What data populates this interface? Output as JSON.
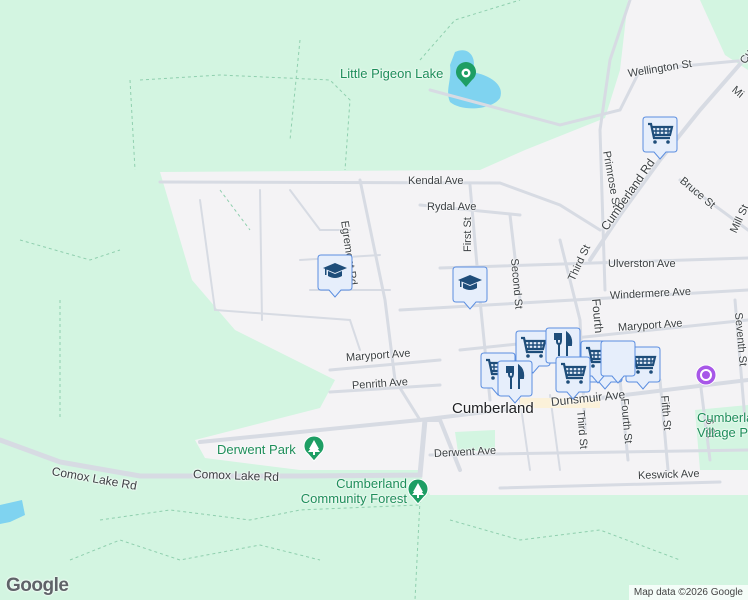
{
  "map": {
    "town_label": "Cumberland",
    "streets": [
      "Kendal Ave",
      "Rydal Ave",
      "Egremont Rd",
      "First St",
      "Second St",
      "Third St",
      "Primrose St",
      "Cumberland Rd",
      "Wellington St",
      "Bruce St",
      "Mill St",
      "Ulverston Ave",
      "Windermere Ave",
      "Maryport Ave",
      "Maryport Ave",
      "Penrith Ave",
      "Dunsmuir Ave",
      "Third St",
      "Fourth St",
      "Fifth St",
      "Seventh St",
      "6 St",
      "Derwent Ave",
      "Keswick Ave",
      "Comox Lake Rd",
      "Comox Lake Rd",
      "Fourth",
      "Cu",
      "Mi"
    ],
    "places": [
      {
        "name": "Little Pigeon Lake",
        "type": "park"
      },
      {
        "name": "Derwent Park",
        "type": "park"
      },
      {
        "name": "Cumberland Community Forest",
        "type": "park"
      },
      {
        "name": "Cumberland Village P",
        "type": "park"
      }
    ],
    "markers": [
      "school",
      "school",
      "grocery",
      "grocery",
      "restaurant",
      "grocery",
      "cafe",
      "grocery",
      "restaurant",
      "grocery",
      "grocery",
      "museum"
    ],
    "colors": {
      "park": "#d3f5e1",
      "urban": "#f4f3f5",
      "road": "#d7dbe3",
      "water": "#7fd3f0",
      "pin": "#1e4d7a",
      "pin_bg": "#e6eefb",
      "park_pin": "#1e9e64"
    }
  },
  "branding": {
    "logo": "Google",
    "attribution": "Map data ©2026 Google"
  }
}
